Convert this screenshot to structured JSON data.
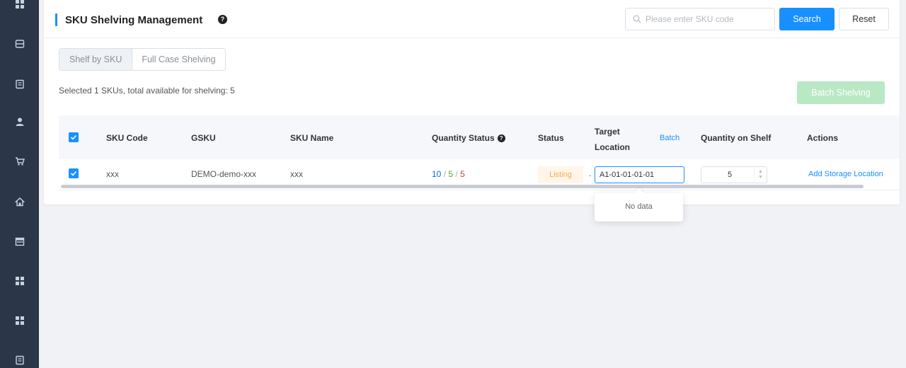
{
  "sidebar": {
    "icons": [
      "grid-icon",
      "inbox-icon",
      "document-icon",
      "user-icon",
      "cart-icon",
      "home-icon",
      "calendar-icon",
      "grid-icon",
      "grid-icon",
      "document-icon"
    ]
  },
  "header": {
    "title": "SKU Shelving Management",
    "help_glyph": "?"
  },
  "search": {
    "placeholder": "Please enter SKU code",
    "search_label": "Search",
    "reset_label": "Reset"
  },
  "tabs": [
    {
      "label": "Shelf by SKU",
      "active": true
    },
    {
      "label": "Full Case Shelving",
      "active": false
    }
  ],
  "selection_info": "Selected 1 SKUs, total available for shelving: 5",
  "batch_shelving_label": "Batch Shelving",
  "table": {
    "headers": {
      "sku_code": "SKU Code",
      "gsku": "GSKU",
      "sku_name": "SKU Name",
      "quantity_status": "Quantity Status",
      "status": "Status",
      "target_location_line1": "Target",
      "target_location_line2": "Location",
      "batch": "Batch",
      "quantity_on_shelf": "Quantity on Shelf",
      "actions": "Actions"
    },
    "rows": [
      {
        "checked": true,
        "sku_code": "xxx",
        "gsku": "DEMO-demo-xxx",
        "sku_name": "xxx",
        "quantity_status": {
          "total": "10",
          "available": "5",
          "other": "5",
          "separator": "/"
        },
        "status": "Listing",
        "status_suffix": ".",
        "target_location": "A1-01-01-01-01",
        "quantity_on_shelf": "5",
        "action": "Add Storage Location"
      }
    ]
  },
  "dropdown": {
    "empty_text": "No data"
  },
  "colors": {
    "accent": "#1890ff",
    "sidebar_bg": "#2b3648",
    "status_listing": "#f7a94e",
    "batch_disabled": "#b9e8c5"
  }
}
